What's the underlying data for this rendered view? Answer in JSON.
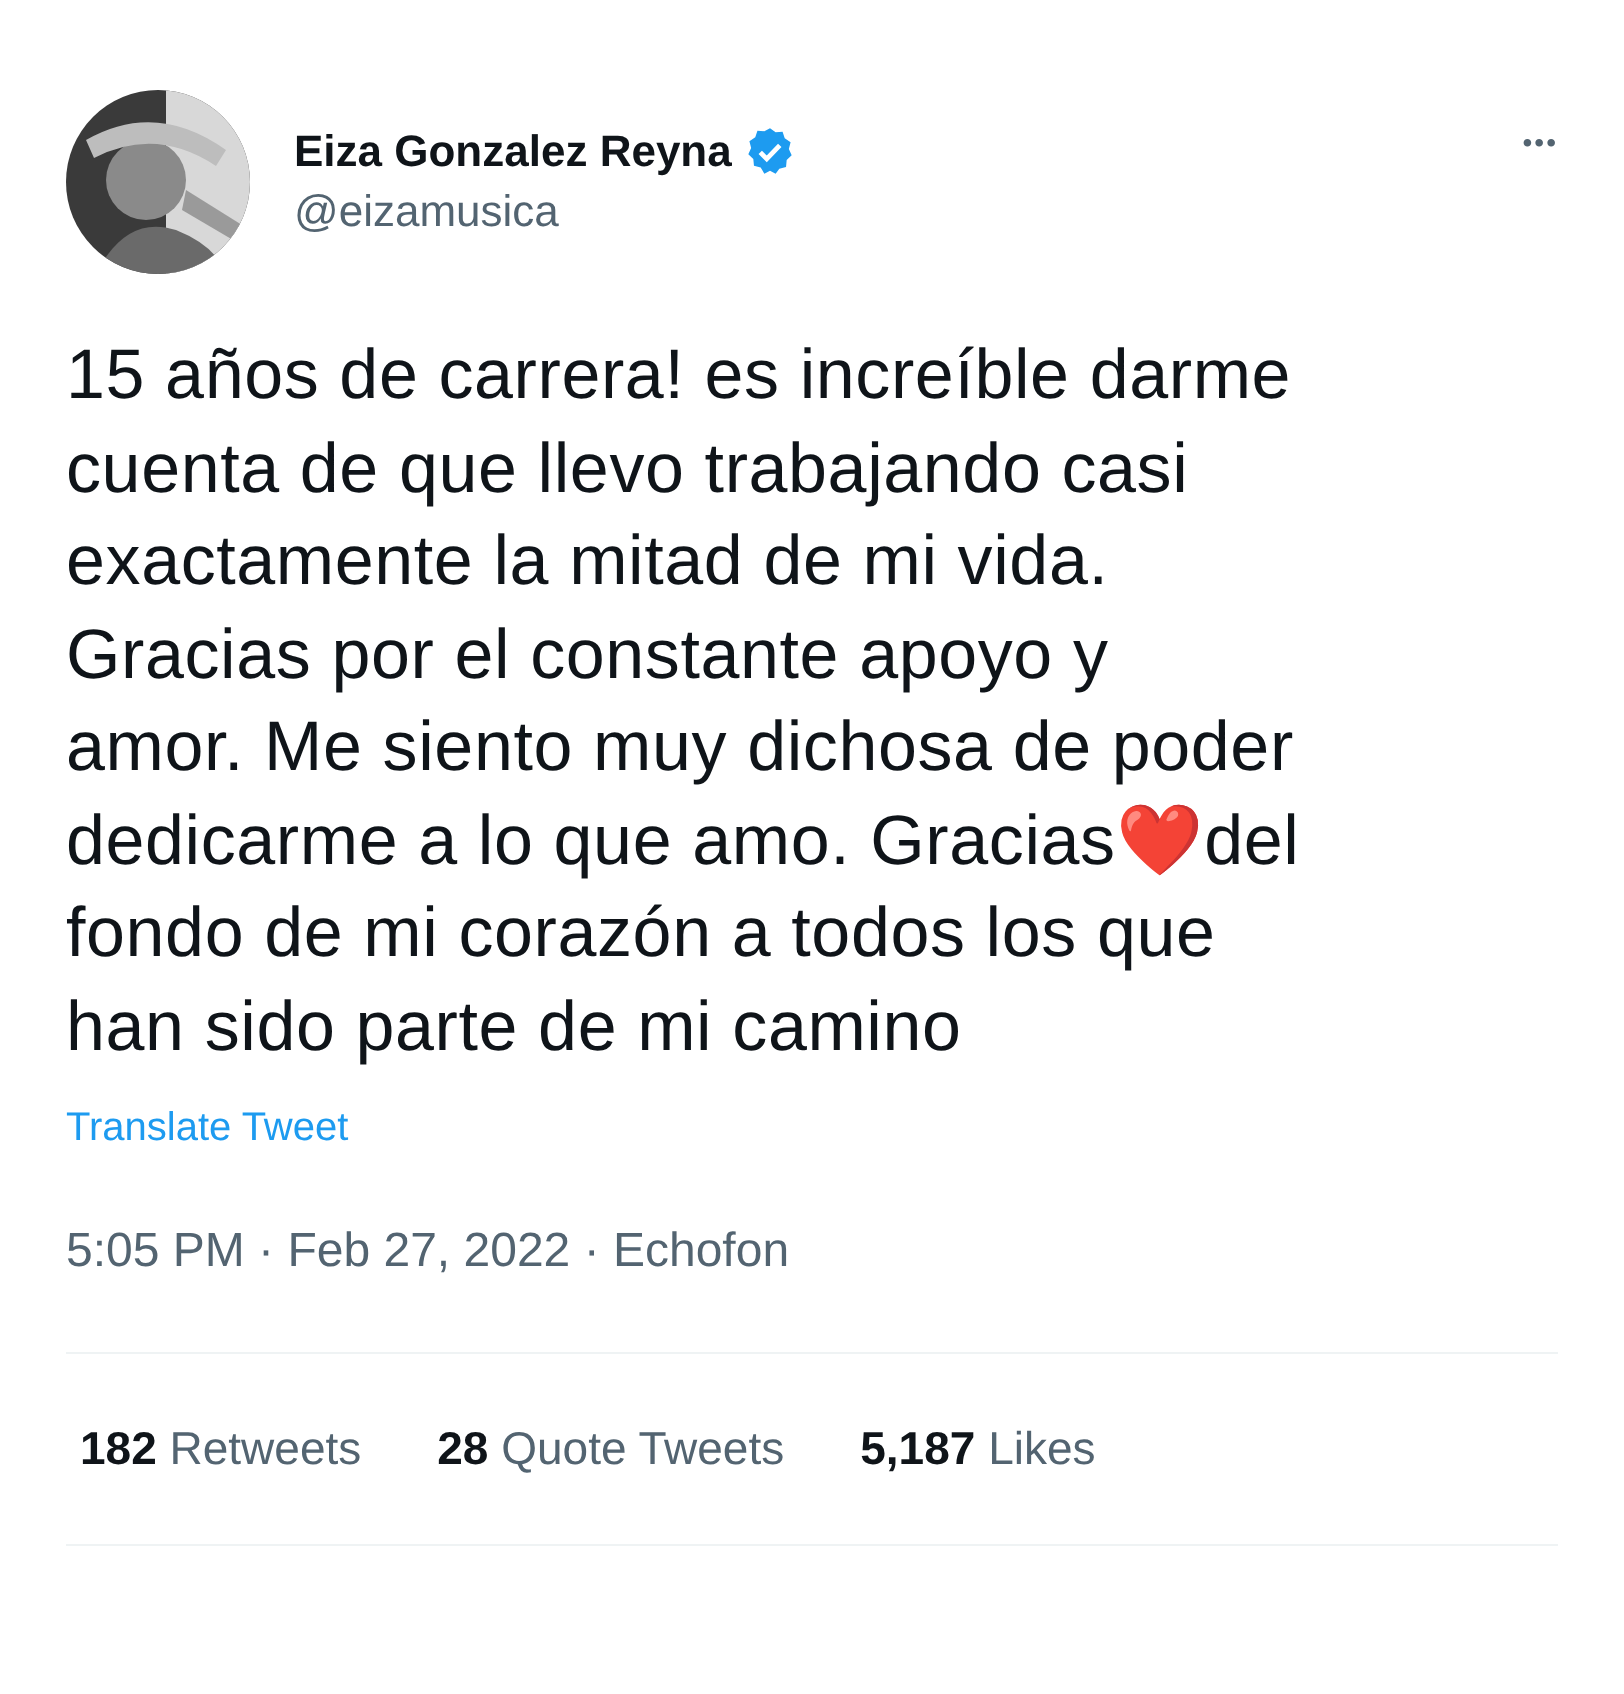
{
  "author": {
    "name": "Eiza Gonzalez Reyna",
    "verified": true,
    "handle": "@eizamusica"
  },
  "more_label": "•••",
  "body_lines": [
    "15 años de carrera! es increíble darme",
    "cuenta de que llevo trabajando casi",
    "exactamente la mitad de mi vida.",
    "Gracias por el constante apoyo y",
    "amor. Me siento muy dichosa de poder",
    "dedicarme a lo que amo. Gracias❤️del",
    "fondo de mi corazón a todos los que",
    "han sido parte de mi camino"
  ],
  "translate_link": "Translate Tweet",
  "meta": "5:05 PM · Feb 27, 2022 · Echofon",
  "stats": [
    {
      "count": "182",
      "label": "Retweets"
    },
    {
      "count": "28",
      "label": "Quote Tweets"
    },
    {
      "count": "5,187",
      "label": "Likes"
    }
  ]
}
